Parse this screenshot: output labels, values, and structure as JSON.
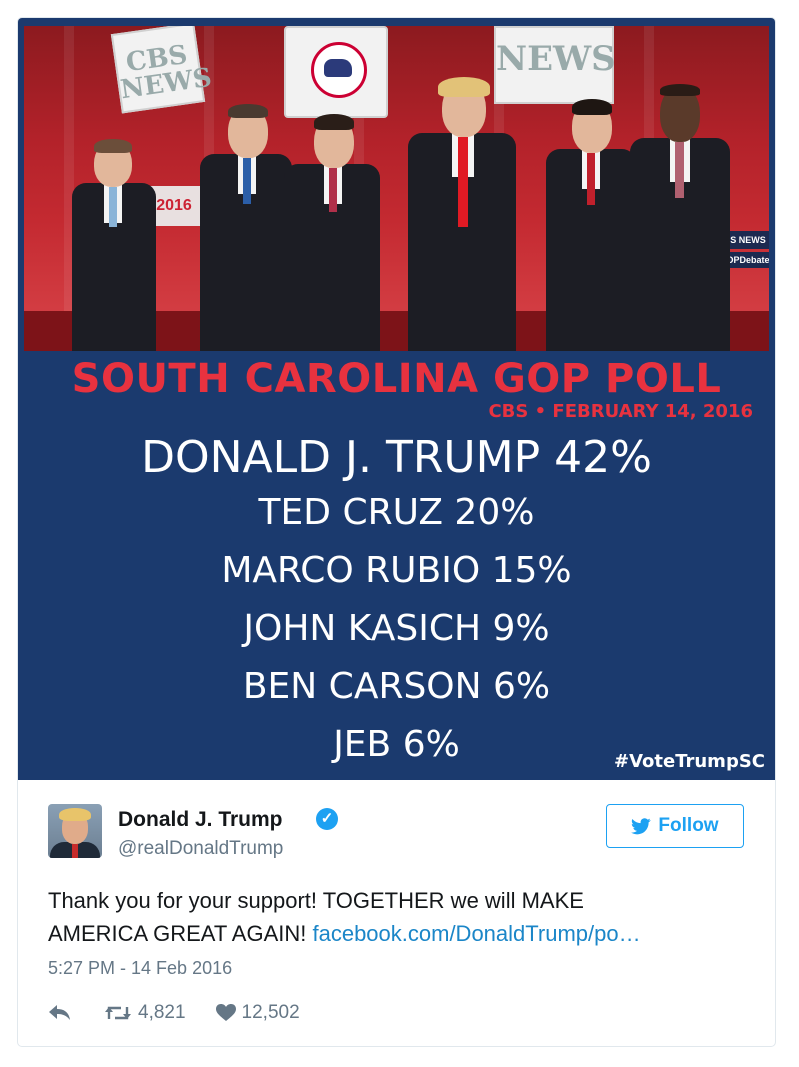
{
  "poll": {
    "title": "SOUTH CAROLINA GOP POLL",
    "subtitle": "CBS • FEBRUARY 14, 2016",
    "lines": [
      "DONALD J. TRUMP 42%",
      "TED CRUZ 20%",
      "MARCO RUBIO 15%",
      "JOHN KASICH 9%",
      "BEN CARSON 6%",
      "JEB 6%"
    ],
    "hashtag": "#VoteTrumpSC"
  },
  "photo": {
    "banner_left": "CBS NEWS",
    "banner_right": "NEWS",
    "sign_year": "2016",
    "sign_news": "S NEWS",
    "sign_debate": "OPDebate"
  },
  "tweet": {
    "name": "Donald J. Trump",
    "handle": "@realDonaldTrump",
    "follow_label": "Follow",
    "text_line1": "Thank you for your support! TOGETHER we will MAKE",
    "text_line2_prefix": "AMERICA GREAT AGAIN! ",
    "link_text": "facebook.com/DonaldTrump/po…",
    "timestamp": "5:27 PM - 14 Feb 2016",
    "retweets": "4,821",
    "likes": "12,502"
  },
  "icons": {
    "verified": "verified-badge-icon",
    "follow": "twitter-bird-icon",
    "reply": "reply-icon",
    "retweet": "retweet-icon",
    "like": "heart-icon"
  },
  "colors": {
    "twitter_blue": "#1da1f2",
    "poll_red": "#e8323f",
    "poll_background": "#1b3a6e"
  }
}
